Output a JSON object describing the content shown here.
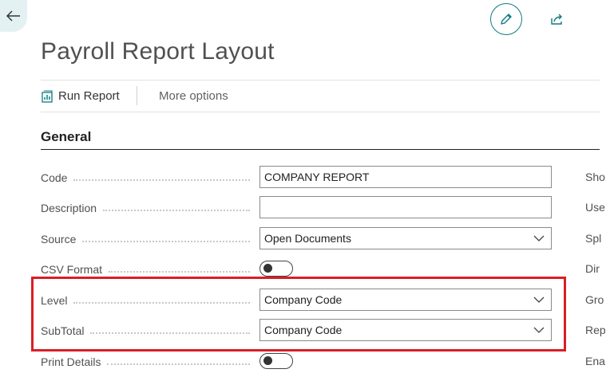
{
  "header": {
    "title": "Payroll Report Layout"
  },
  "actions": {
    "run_report": "Run Report",
    "more_options": "More options"
  },
  "section": {
    "general": "General"
  },
  "fields": {
    "code": {
      "label": "Code",
      "value": "COMPANY REPORT"
    },
    "description": {
      "label": "Description",
      "value": ""
    },
    "source": {
      "label": "Source",
      "value": "Open Documents"
    },
    "csv_format": {
      "label": "CSV Format",
      "checked": false
    },
    "level": {
      "label": "Level",
      "value": "Company Code"
    },
    "subtotal": {
      "label": "SubTotal",
      "value": "Company Code"
    },
    "print_details": {
      "label": "Print Details",
      "checked": false
    }
  },
  "right_column": [
    "Sho",
    "Use",
    "Spl",
    "Dir",
    "Gro",
    "Rep",
    "Ena"
  ],
  "colors": {
    "accent": "#0f7b83",
    "highlight": "#d81f26"
  },
  "icons": {
    "back": "arrow-left-icon",
    "edit": "pencil-icon",
    "share": "share-icon",
    "report": "report-chart-icon",
    "chevron": "chevron-down-icon"
  }
}
